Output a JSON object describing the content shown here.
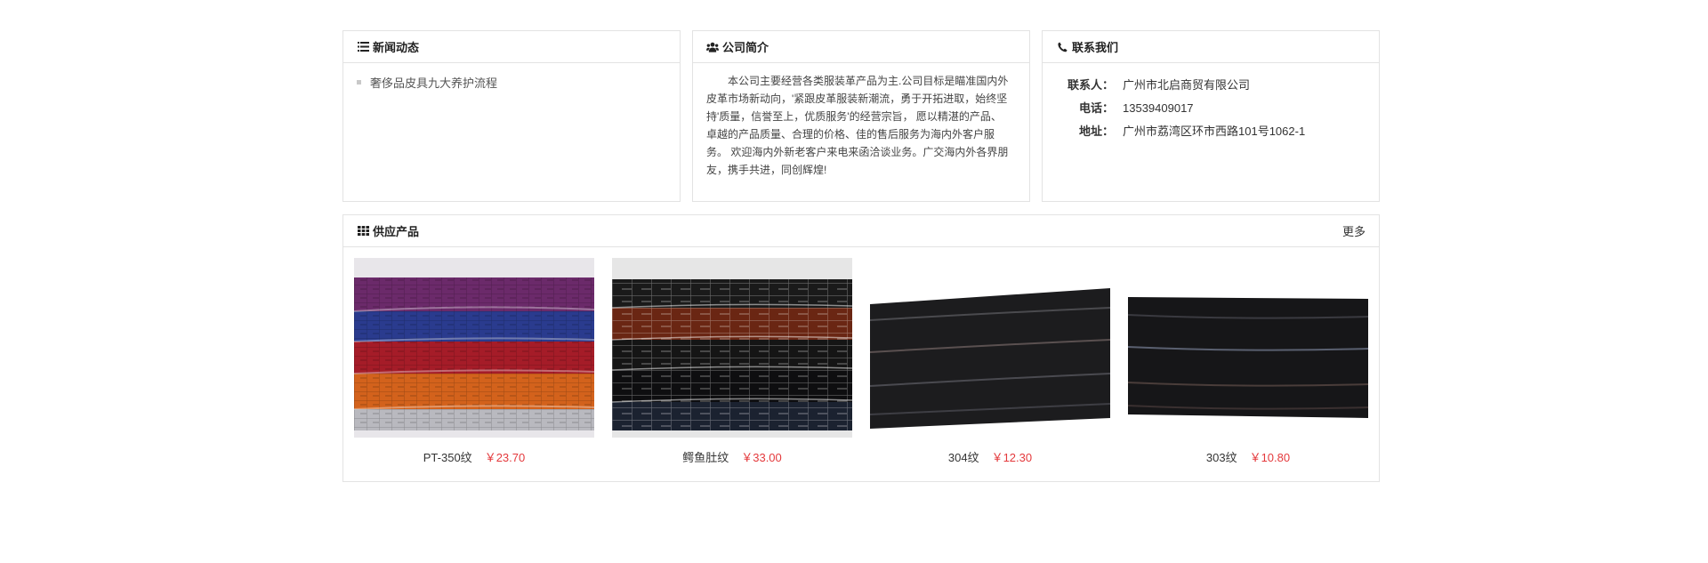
{
  "news": {
    "title": "新闻动态",
    "items": [
      {
        "text": "奢侈品皮具九大养护流程"
      }
    ]
  },
  "intro": {
    "title": "公司简介",
    "text": "本公司主要经营各类服装革产品为主.公司目标是瞄准国内外皮革市场新动向，'紧跟皮革服装新潮流，勇于开拓进取，始终坚持'质量，信誉至上，优质服务'的经营宗旨， 愿以精湛的产品、卓越的产品质量、合理的价格、佳的售后服务为海内外客户服务。 欢迎海内外新老客户来电来函洽谈业务。广交海内外各界朋友，携手共进，同创辉煌!"
  },
  "contact": {
    "title": "联系我们",
    "rows": [
      {
        "label": "联系人：",
        "value": "广州市北启商贸有限公司"
      },
      {
        "label": "电话：",
        "value": "13539409017"
      },
      {
        "label": "地址：",
        "value": "广州市荔湾区环市西路101号1062-1"
      }
    ]
  },
  "products": {
    "title": "供应产品",
    "more": "更多",
    "items": [
      {
        "name": "PT-350纹",
        "price": "￥23.70"
      },
      {
        "name": "鳄鱼肚纹",
        "price": "￥33.00"
      },
      {
        "name": "304纹",
        "price": "￥12.30"
      },
      {
        "name": "303纹",
        "price": "￥10.80"
      }
    ]
  }
}
